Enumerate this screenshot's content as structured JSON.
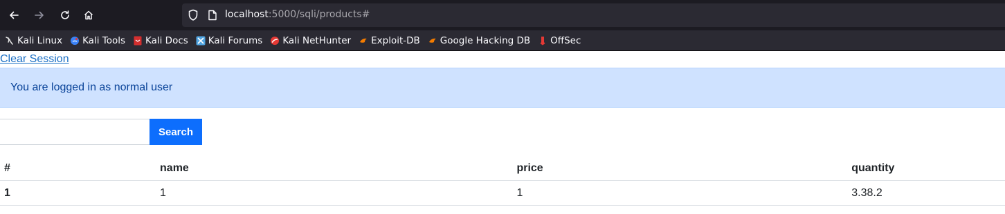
{
  "browser": {
    "url_host": "localhost",
    "url_path": ":5000/sqli/products#",
    "bookmarks": [
      {
        "label": "Kali Linux",
        "icon": "kali-dragon-icon",
        "color": "#e6e6e6"
      },
      {
        "label": "Kali Tools",
        "icon": "kali-tools-icon",
        "color": "#3b82f6"
      },
      {
        "label": "Kali Docs",
        "icon": "kali-docs-icon",
        "color": "#d32f2f"
      },
      {
        "label": "Kali Forums",
        "icon": "kali-forums-icon",
        "color": "#4fa3e0"
      },
      {
        "label": "Kali NetHunter",
        "icon": "nethunter-icon",
        "color": "#e53935"
      },
      {
        "label": "Exploit-DB",
        "icon": "exploit-db-icon",
        "color": "#f57c00"
      },
      {
        "label": "Google Hacking DB",
        "icon": "ghdb-icon",
        "color": "#f57c00"
      },
      {
        "label": "OffSec",
        "icon": "offsec-icon",
        "color": "#e53935"
      }
    ]
  },
  "page": {
    "clear_session_label": "Clear Session",
    "alert_text": "You are logged in as normal user",
    "search": {
      "value": "",
      "placeholder": "",
      "button_label": "Search"
    },
    "table": {
      "headers": [
        "#",
        "name",
        "price",
        "quantity"
      ],
      "rows": [
        [
          "1",
          "1",
          "1",
          "3.38.2"
        ]
      ]
    }
  }
}
